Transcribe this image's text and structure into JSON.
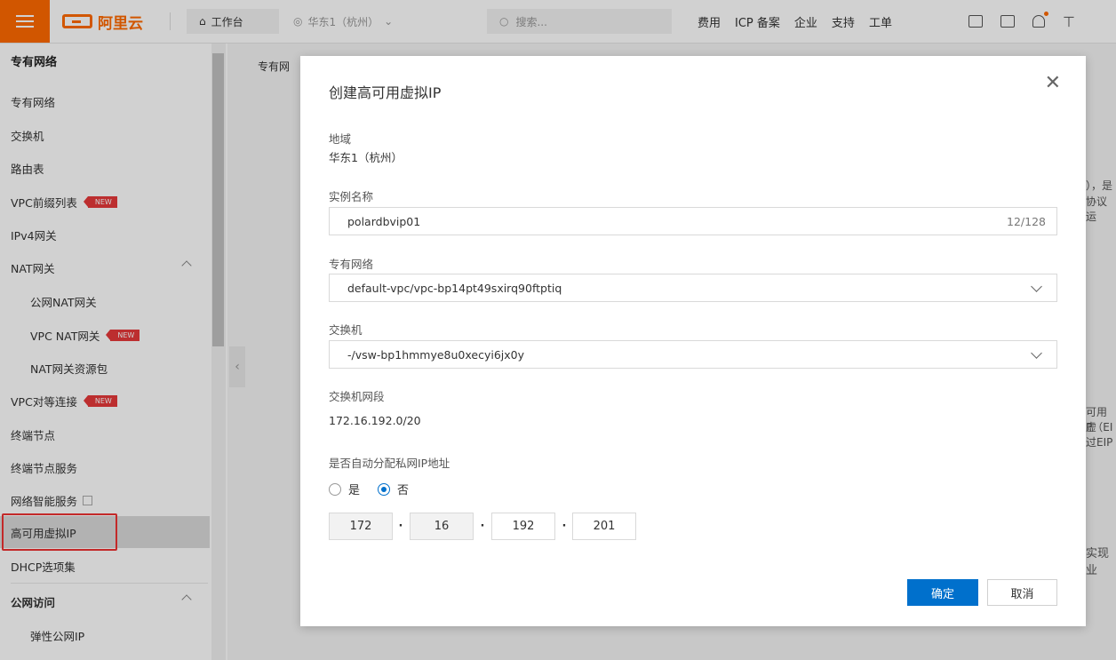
{
  "topbar": {
    "logo_text": "阿里云",
    "workbench": "工作台",
    "region": "华东1（杭州）",
    "search_placeholder": "搜索...",
    "nav": [
      "费用",
      "ICP 备案",
      "企业",
      "支持",
      "工单"
    ]
  },
  "sidebar": {
    "title": "专有网络",
    "items": [
      {
        "label": "专有网络"
      },
      {
        "label": "交换机"
      },
      {
        "label": "路由表"
      },
      {
        "label": "VPC前缀列表",
        "badge": "NEW"
      },
      {
        "label": "IPv4网关"
      },
      {
        "label": "NAT网关"
      },
      {
        "label": "公网NAT网关"
      },
      {
        "label": "VPC NAT网关",
        "badge": "NEW"
      },
      {
        "label": "NAT网关资源包"
      },
      {
        "label": "VPC对等连接",
        "badge": "NEW"
      },
      {
        "label": "终端节点"
      },
      {
        "label": "终端节点服务"
      },
      {
        "label": "网络智能服务"
      },
      {
        "label": "高可用虚拟IP"
      },
      {
        "label": "DHCP选项集"
      },
      {
        "label": "公网访问"
      },
      {
        "label": "弹性公网IP"
      }
    ]
  },
  "background": {
    "breadcrumb": "专有网",
    "snippets": [
      "），是",
      "协议运",
      "可用虚",
      "P（EI",
      "过EIP",
      "实现业"
    ]
  },
  "dialog": {
    "title": "创建高可用虚拟IP",
    "region_label": "地域",
    "region_value": "华东1（杭州）",
    "name_label": "实例名称",
    "name_value": "polardbvip01",
    "name_count": "12/128",
    "vpc_label": "专有网络",
    "vpc_value": "default-vpc/vpc-bp14pt49sxirq90ftptiq",
    "vswitch_label": "交换机",
    "vswitch_value": "-/vsw-bp1hmmye8u0xecyi6jx0y",
    "cidr_label": "交换机网段",
    "cidr_value": "172.16.192.0/20",
    "auto_label": "是否自动分配私网IP地址",
    "option_yes": "是",
    "option_no": "否",
    "ip": [
      "172",
      "16",
      "192",
      "201"
    ],
    "ok": "确定",
    "cancel": "取消"
  }
}
